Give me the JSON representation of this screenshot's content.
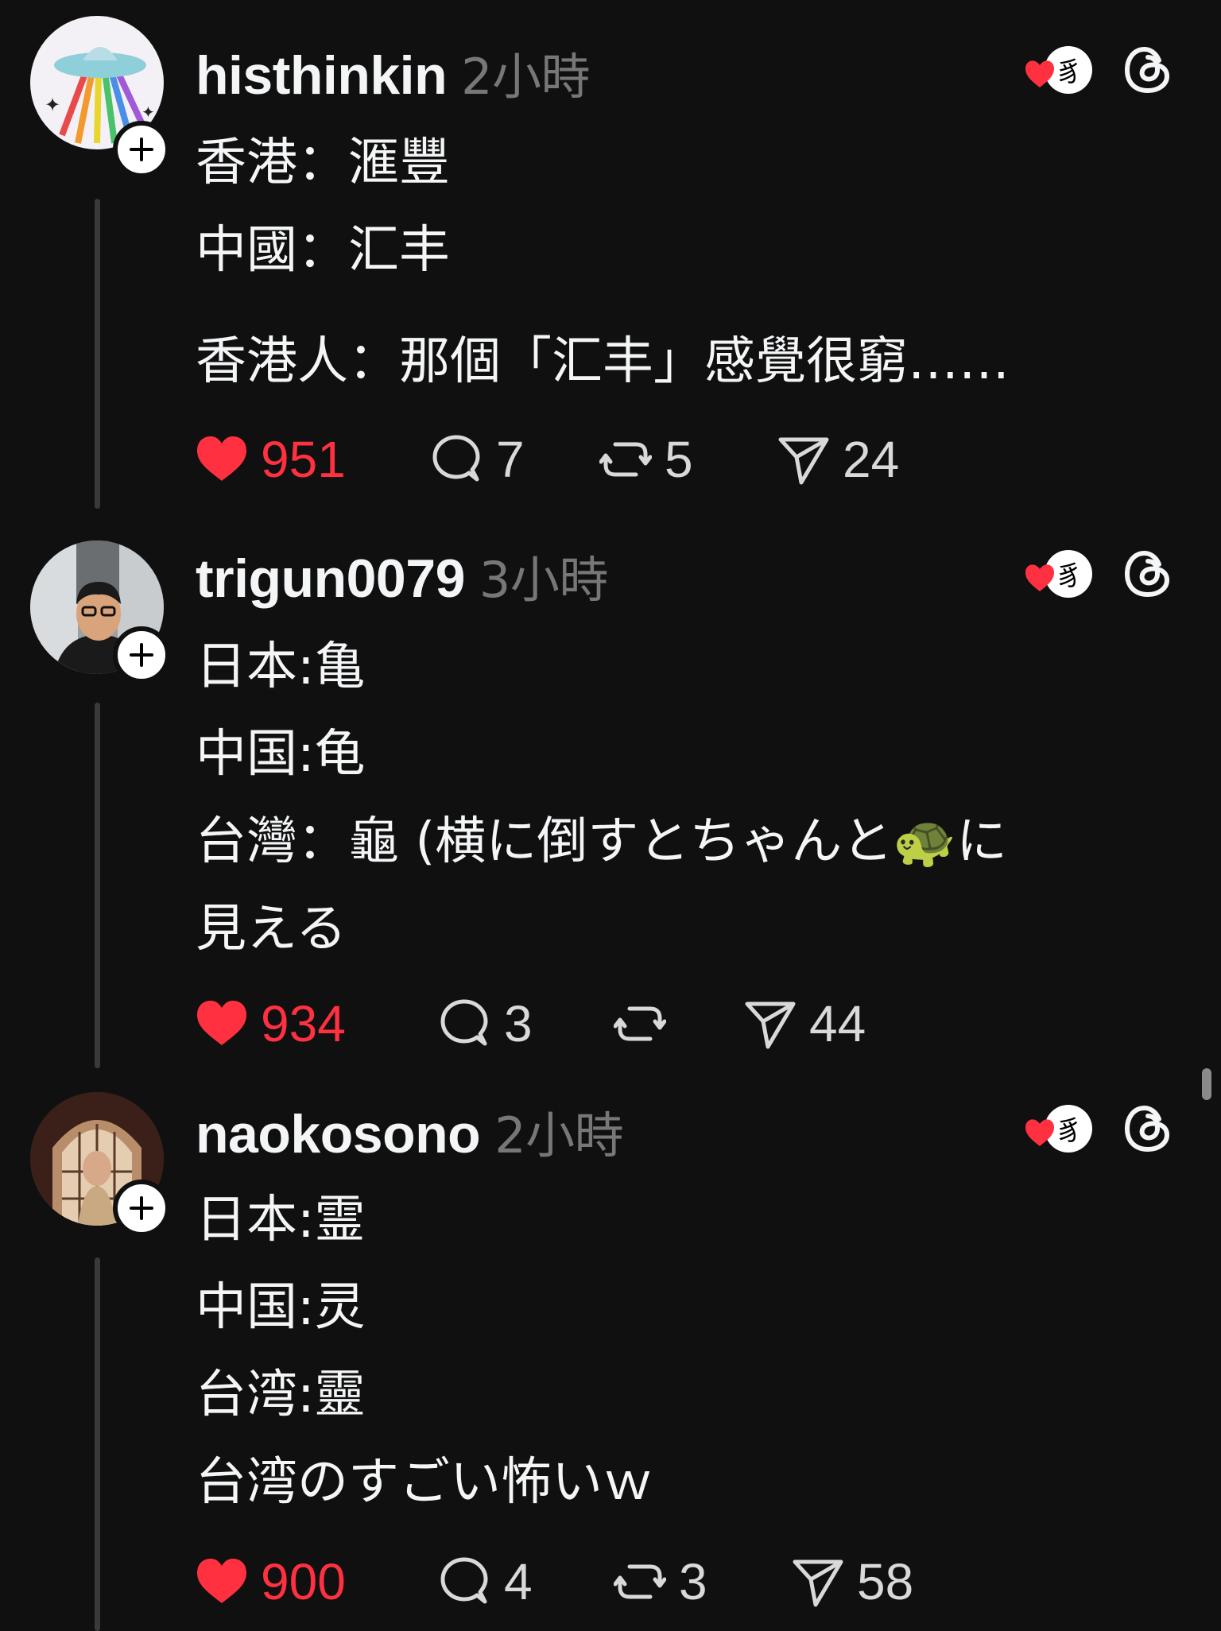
{
  "posts": [
    {
      "username": "histhinkin",
      "time": "2小時",
      "lines": [
        "香港：滙豐",
        "中國：汇丰",
        "香港人：那個「汇丰」感覺很窮……"
      ],
      "likes": "951",
      "comments": "7",
      "reposts": "5",
      "shares": "24"
    },
    {
      "username": "trigun0079",
      "time": "3小時",
      "lines": [
        "日本:亀",
        "中国:龟",
        "台灣：龜 (横に倒すとちゃんと🐢に",
        "見える"
      ],
      "likes": "934",
      "comments": "3",
      "reposts": "",
      "shares": "44"
    },
    {
      "username": "naokosono",
      "time": "2小時",
      "lines": [
        "日本:霊",
        "中国:灵",
        "台湾:靈",
        "台湾のすごい怖いｗ"
      ],
      "likes": "900",
      "comments": "4",
      "reposts": "3",
      "shares": "58"
    }
  ],
  "colors": {
    "background": "#101010",
    "like": "#ff3040",
    "muted": "#777777"
  },
  "icons": [
    "plus-icon",
    "heart-icon",
    "comment-icon",
    "repost-icon",
    "send-icon",
    "threads-icon",
    "liked-badge-icon"
  ]
}
